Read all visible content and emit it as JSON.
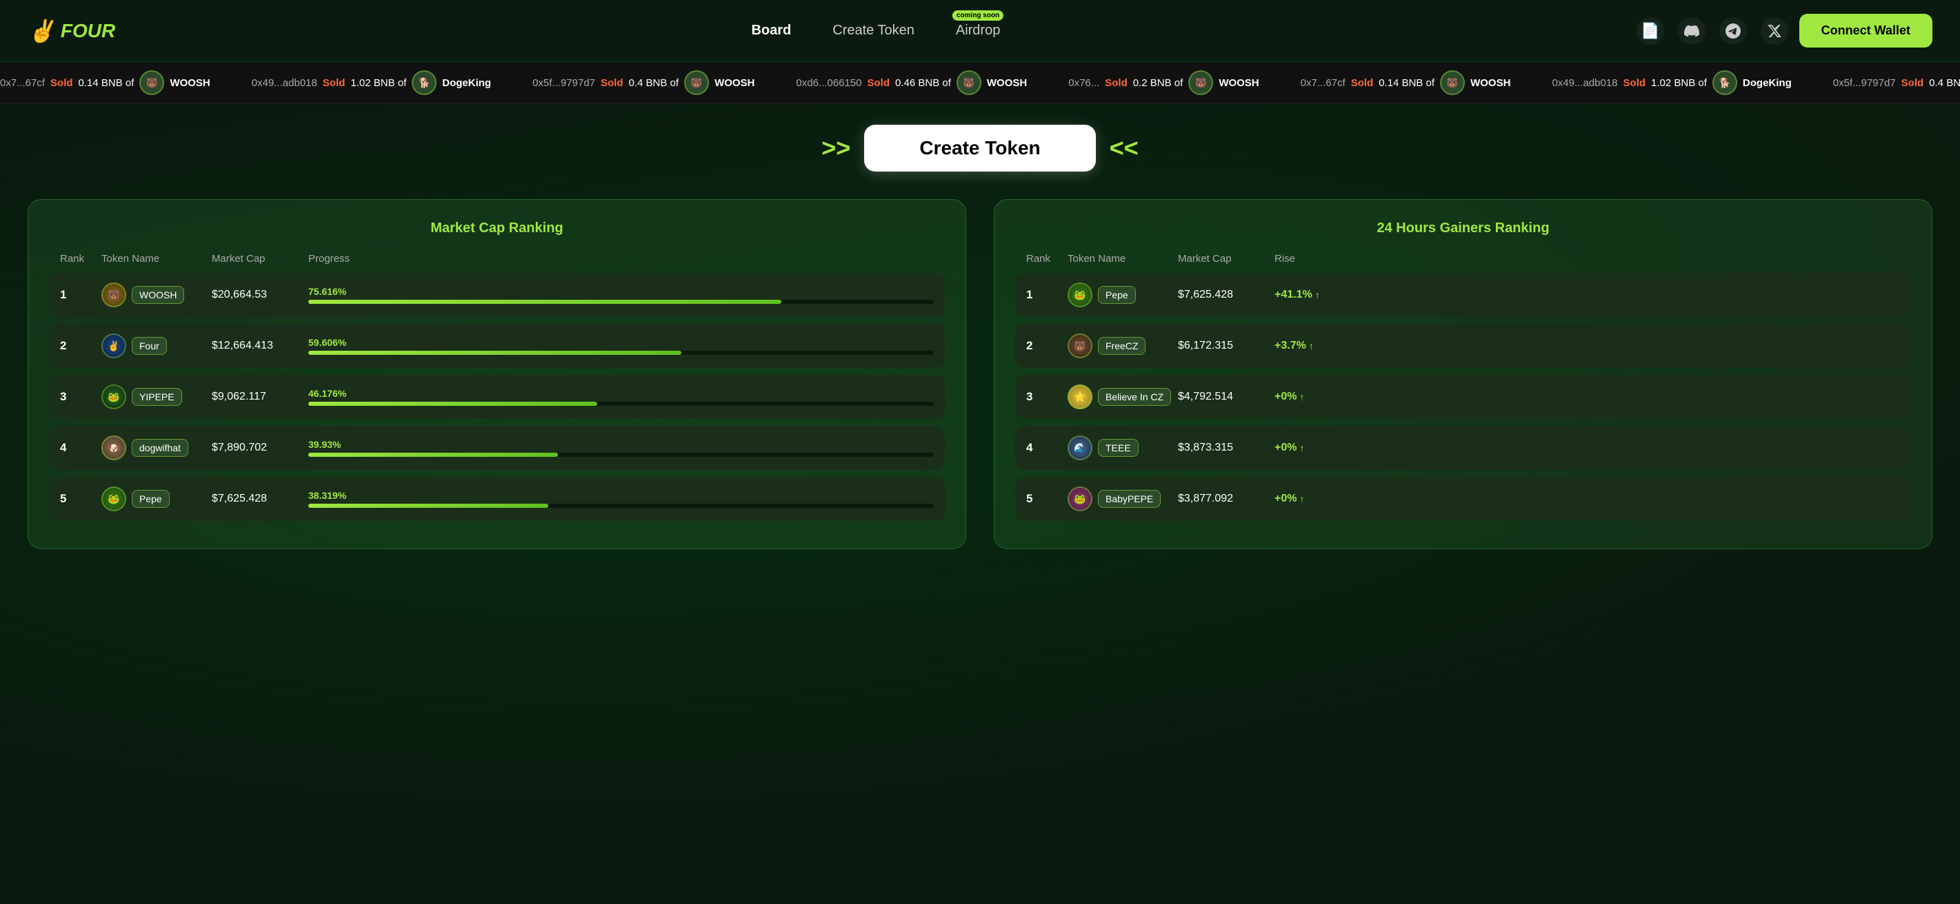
{
  "navbar": {
    "logo_text": "FOUR",
    "logo_icon": "✌️",
    "links": [
      {
        "id": "board",
        "label": "Board",
        "active": true,
        "badge": null
      },
      {
        "id": "create-token",
        "label": "Create Token",
        "active": false,
        "badge": null
      },
      {
        "id": "airdrop",
        "label": "Airdrop",
        "active": false,
        "badge": "coming soon"
      }
    ],
    "icons": [
      {
        "id": "docs",
        "symbol": "📄"
      },
      {
        "id": "discord",
        "symbol": "◎"
      },
      {
        "id": "telegram",
        "symbol": "✈"
      },
      {
        "id": "twitter",
        "symbol": "𝕏"
      }
    ],
    "connect_wallet_label": "Connect Wallet"
  },
  "ticker": {
    "items": [
      {
        "addr": "0x7...67cf",
        "action": "Sold",
        "amount": "0.14 BNB of",
        "token": "WOOSH",
        "avatar": "🐻"
      },
      {
        "addr": "0x49...adb018",
        "action": "Sold",
        "amount": "1.02 BNB of",
        "token": "DogeKing",
        "avatar": "🐕"
      },
      {
        "addr": "0x5f...9797d7",
        "action": "Sold",
        "amount": "0.4 BNB of",
        "token": "WOOSH",
        "avatar": "🐻"
      },
      {
        "addr": "0xd6...066150",
        "action": "Sold",
        "amount": "0.46 BNB of",
        "token": "WOOSH",
        "avatar": "🐻"
      },
      {
        "addr": "0x76...",
        "action": "Sold",
        "amount": "0.2 BNB of",
        "token": "WOOSH",
        "avatar": "🐻"
      }
    ]
  },
  "hero": {
    "create_token_label": "Create Token",
    "chevron_left": ">>",
    "chevron_right": "<<"
  },
  "market_cap_ranking": {
    "title": "Market Cap Ranking",
    "headers": [
      "Rank",
      "Token Name",
      "Market Cap",
      "Progress"
    ],
    "rows": [
      {
        "rank": 1,
        "name": "WOOSH",
        "market_cap": "$20,664.53",
        "progress": 75.616,
        "progress_label": "75.616%",
        "avatar": "🐻",
        "avatar_class": "avatar-woosh"
      },
      {
        "rank": 2,
        "name": "Four",
        "market_cap": "$12,664.413",
        "progress": 59.606,
        "progress_label": "59.606%",
        "avatar": "✌️",
        "avatar_class": "avatar-four"
      },
      {
        "rank": 3,
        "name": "YIPEPE",
        "market_cap": "$9,062.117",
        "progress": 46.176,
        "progress_label": "46.176%",
        "avatar": "🐸",
        "avatar_class": "avatar-yipepe"
      },
      {
        "rank": 4,
        "name": "dogwifhat",
        "market_cap": "$7,890.702",
        "progress": 39.93,
        "progress_label": "39.93%",
        "avatar": "🐶",
        "avatar_class": "avatar-dogwifhat"
      },
      {
        "rank": 5,
        "name": "Pepe",
        "market_cap": "$7,625.428",
        "progress": 38.319,
        "progress_label": "38.319%",
        "avatar": "🐸",
        "avatar_class": "avatar-pepe"
      }
    ]
  },
  "gainers_ranking": {
    "title": "24 Hours Gainers Ranking",
    "headers": [
      "Rank",
      "Token Name",
      "Market Cap",
      "Rise"
    ],
    "rows": [
      {
        "rank": 1,
        "name": "Pepe",
        "market_cap": "$7,625.428",
        "rise": "+41.1%",
        "avatar": "🐸",
        "avatar_class": "avatar-pepe"
      },
      {
        "rank": 2,
        "name": "FreeCZ",
        "market_cap": "$6,172.315",
        "rise": "+3.7%",
        "avatar": "🐻",
        "avatar_class": "avatar-freecz"
      },
      {
        "rank": 3,
        "name": "Believe In CZ",
        "market_cap": "$4,792.514",
        "rise": "+0%",
        "avatar": "⭐",
        "avatar_class": "avatar-believeincz"
      },
      {
        "rank": 4,
        "name": "TEEE",
        "market_cap": "$3,873.315",
        "rise": "+0%",
        "avatar": "🌊",
        "avatar_class": "avatar-teee"
      },
      {
        "rank": 5,
        "name": "BabyPEPE",
        "market_cap": "$3,877.092",
        "rise": "+0%",
        "avatar": "🐸",
        "avatar_class": "avatar-babypepe"
      }
    ]
  }
}
